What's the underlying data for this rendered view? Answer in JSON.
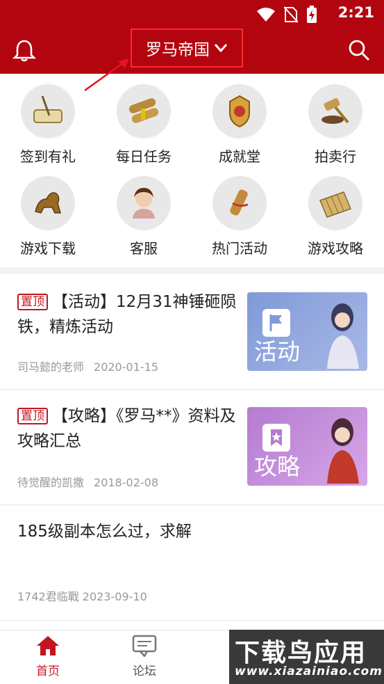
{
  "status_bar": {
    "time": "2:21"
  },
  "header": {
    "title": "罗马帝国"
  },
  "shortcuts": [
    {
      "label": "签到有礼",
      "icon": "scroll-quill-icon"
    },
    {
      "label": "每日任务",
      "icon": "scroll-bundle-icon"
    },
    {
      "label": "成就堂",
      "icon": "trophy-crest-icon"
    },
    {
      "label": "拍卖行",
      "icon": "auction-gavel-icon"
    },
    {
      "label": "游戏下载",
      "icon": "bronze-beast-icon"
    },
    {
      "label": "客服",
      "icon": "support-avatar-icon"
    },
    {
      "label": "热门活动",
      "icon": "ribbon-scroll-icon"
    },
    {
      "label": "游戏攻略",
      "icon": "bamboo-scroll-icon"
    }
  ],
  "feed": [
    {
      "tag": "置顶",
      "title": "【活动】12月31神锤砸陨铁，精炼活动",
      "author": "司马懿的老师",
      "date": "2020-01-15",
      "thumb_label": "活动",
      "thumb_color": "#8ea4dc"
    },
    {
      "tag": "置顶",
      "title": "【攻略】《罗马**》资料及攻略汇总",
      "author": "待觉醒的凯撒",
      "date": "2018-02-08",
      "thumb_label": "攻略",
      "thumb_color": "#c28bd8"
    },
    {
      "title": "185级副本怎么过，求解",
      "meta": "1742君临戰 2023-09-10"
    }
  ],
  "tabs": [
    {
      "label": "首页",
      "active": true
    },
    {
      "label": "论坛",
      "active": false
    }
  ],
  "watermark": {
    "main": "下载鸟应用",
    "sub": "www.xiazainiao.com"
  },
  "colors": {
    "brand": "#b3050f",
    "tag": "#c3151f"
  }
}
